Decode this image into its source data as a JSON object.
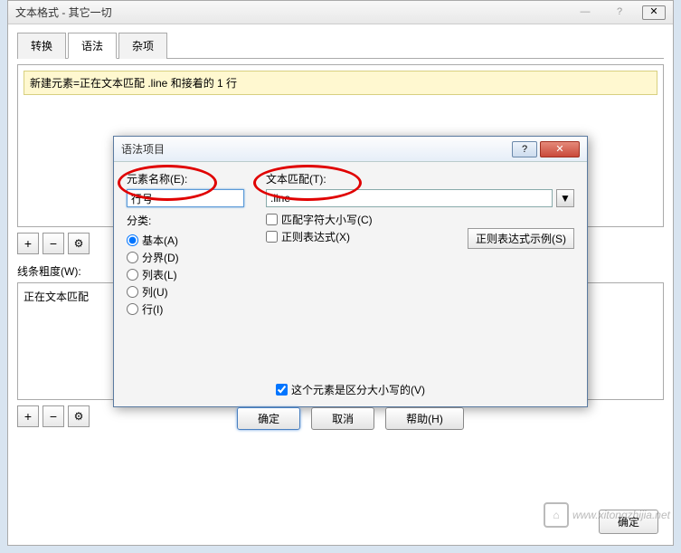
{
  "main": {
    "title": "文本格式 - 其它一切",
    "tabs": [
      "转换",
      "语法",
      "杂项"
    ],
    "active_tab": 1,
    "yellow_row": "新建元素=正在文本匹配 .line 和接着的 1 行",
    "toolbar": {
      "add": "+",
      "remove": "−",
      "gear": "⚙"
    },
    "thickness_label": "线条粗度(W):",
    "thickness_value": "正在文本匹配",
    "footer_ok": "确定"
  },
  "win_controls": {
    "min": "—",
    "help": "?",
    "close": "✕"
  },
  "modal": {
    "title": "语法项目",
    "element_name_label": "元素名称(E):",
    "element_name_value": "行号",
    "category_label": "分类:",
    "categories": [
      {
        "label": "基本(A)",
        "checked": true
      },
      {
        "label": "分界(D)",
        "checked": false
      },
      {
        "label": "列表(L)",
        "checked": false
      },
      {
        "label": "列(U)",
        "checked": false
      },
      {
        "label": "行(I)",
        "checked": false
      }
    ],
    "text_match_label": "文本匹配(T):",
    "text_match_value": ".line",
    "match_case_label": "匹配字符大小写(C)",
    "regex_label": "正则表达式(X)",
    "regex_example_btn": "正则表达式示例(S)",
    "case_sensitive_label": "这个元素是区分大小写的(V)",
    "case_sensitive_checked": true,
    "ok": "确定",
    "cancel": "取消",
    "help": "帮助(H)",
    "win": {
      "help": "?",
      "close": "✕"
    }
  },
  "watermark": "www.xitongzhijia.net"
}
